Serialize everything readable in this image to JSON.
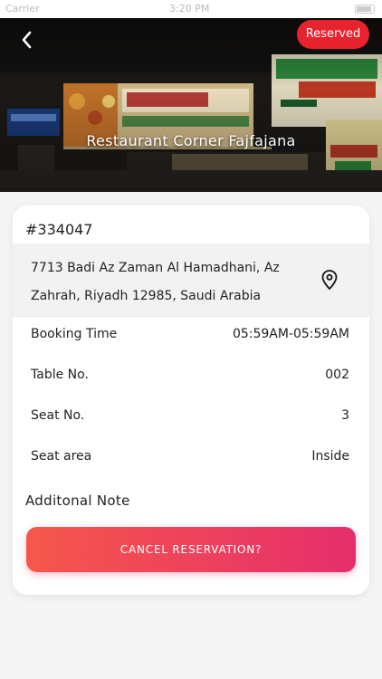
{
  "status_bar": {
    "carrier": "Carrier",
    "time": "3:20 PM"
  },
  "header": {
    "status_badge": "Reserved",
    "restaurant_name": "Restaurant Corner Fajfajana"
  },
  "booking": {
    "id": "#334047",
    "address_line1": "7713 Badi Az Zaman Al Hamadhani, Az",
    "address_line2": "Zahrah, Riyadh 12985, Saudi Arabia"
  },
  "details": [
    {
      "label": "Booking Time",
      "value": "05:59AM-05:59AM"
    },
    {
      "label": "Table No.",
      "value": "002"
    },
    {
      "label": "Seat No.",
      "value": "3"
    },
    {
      "label": "Seat area",
      "value": "Inside"
    }
  ],
  "note": {
    "heading": "Additonal Note"
  },
  "actions": {
    "cancel_label": "CANCEL RESERVATION?"
  },
  "colors": {
    "badge": "#e8232d",
    "button_gradient_start": "#f6574b",
    "button_gradient_end": "#e62e6c"
  },
  "icons": {
    "back": "chevron-left-icon",
    "location": "map-pin-icon"
  }
}
